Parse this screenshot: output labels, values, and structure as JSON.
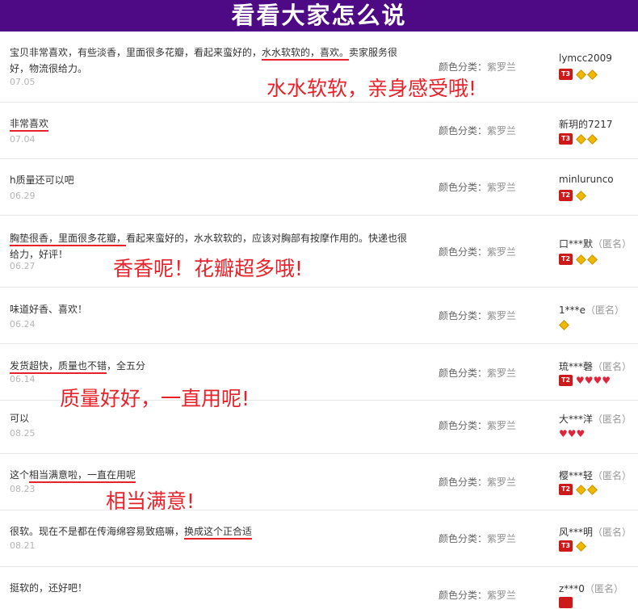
{
  "banner": {
    "title": "看看大家怎么说"
  },
  "category_label": "颜色分类：",
  "reviews": [
    {
      "text_a": "宝贝非常喜欢，有些淡香，里面很多花瓣，看起来蛮好的，",
      "text_u": "水水软软的，喜欢。",
      "text_b": "卖家服务很好，物流很给力。",
      "date": "07.05",
      "category": "紫罗兰",
      "user": "lymcc2009",
      "anon": "",
      "badge": "T3"
    },
    {
      "text_a": "",
      "text_u": "非常喜欢",
      "text_b": "",
      "date": "07.04",
      "category": "紫罗兰",
      "user": "新玥的7217",
      "anon": "",
      "badge": "T3"
    },
    {
      "text_a": "h质量还可以吧",
      "text_u": "",
      "text_b": "",
      "date": "06.29",
      "category": "紫罗兰",
      "user": "minlurunco",
      "anon": "",
      "badge": "T2"
    },
    {
      "text_a": "",
      "text_u": "胸垫很香，里面很多花瓣，",
      "text_b": "看起来蛮好的，水水软软的，应该对胸部有按摩作用的。快递也很给力，好评！",
      "date": "06.27",
      "category": "紫罗兰",
      "user": "口***默",
      "anon": "（匿名）",
      "badge": "T2"
    },
    {
      "text_a": "味道好香、喜欢！",
      "text_u": "",
      "text_b": "",
      "date": "06.24",
      "category": "紫罗兰",
      "user": "1***e",
      "anon": "（匿名）",
      "badge": ""
    },
    {
      "text_a": "",
      "text_u": "发货超快，质量也不错",
      "text_b": "，全五分",
      "date": "06.14",
      "category": "紫罗兰",
      "user": "琉***磬",
      "anon": "（匿名）",
      "badge": "T2"
    },
    {
      "text_a": "可以",
      "text_u": "",
      "text_b": "",
      "date": "08.25",
      "category": "紫罗兰",
      "user": "大***洋",
      "anon": "（匿名）",
      "badge": ""
    },
    {
      "text_a": "这个",
      "text_u": "相当满意啦，一直在用呢",
      "text_b": "",
      "date": "08.23",
      "category": "紫罗兰",
      "user": "樱***轻",
      "anon": "（匿名）",
      "badge": "T2"
    },
    {
      "text_a": "很软。现在不是都在传海绵容易致癌嘛，",
      "text_u": "换成这个正合适",
      "text_b": "",
      "date": "08.21",
      "category": "紫罗兰",
      "user": "风***明",
      "anon": "（匿名）",
      "badge": "T3"
    },
    {
      "text_a": "挺软的，还好吧！",
      "text_u": "",
      "text_b": "",
      "date": "",
      "category": "紫罗兰",
      "user": "z***0",
      "anon": "（匿名）",
      "badge": ""
    }
  ],
  "annotations": {
    "n1": "水水软软，亲身感受哦!",
    "n2": "香香呢！花瓣超多哦!",
    "n3": "质量好好，一直用呢!",
    "n4": "相当满意!"
  },
  "colors": {
    "banner": "#4e0a85",
    "annotation": "#e8222a",
    "badge": "#cc1a1a",
    "diamond": "#f0b800"
  }
}
